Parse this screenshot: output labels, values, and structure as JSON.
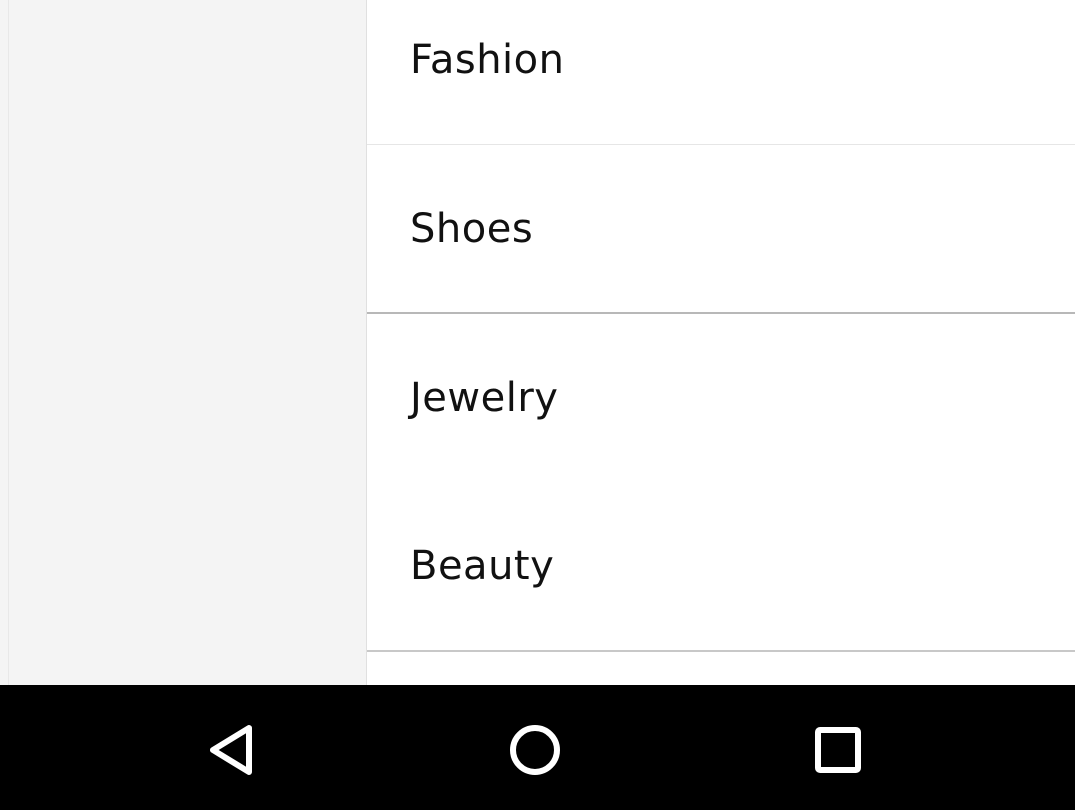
{
  "menu": {
    "items": [
      {
        "label": "Fashion"
      },
      {
        "label": "Shoes"
      },
      {
        "label": "Jewelry"
      },
      {
        "label": "Beauty"
      }
    ]
  },
  "nav_bar": {
    "buttons": [
      {
        "icon": "back-triangle-icon"
      },
      {
        "icon": "home-circle-icon"
      },
      {
        "icon": "recents-square-icon"
      }
    ]
  },
  "colors": {
    "background": "#f4f4f4",
    "menu_background": "#ffffff",
    "text": "#111111",
    "nav_bar": "#000000",
    "nav_icon": "#ffffff"
  }
}
